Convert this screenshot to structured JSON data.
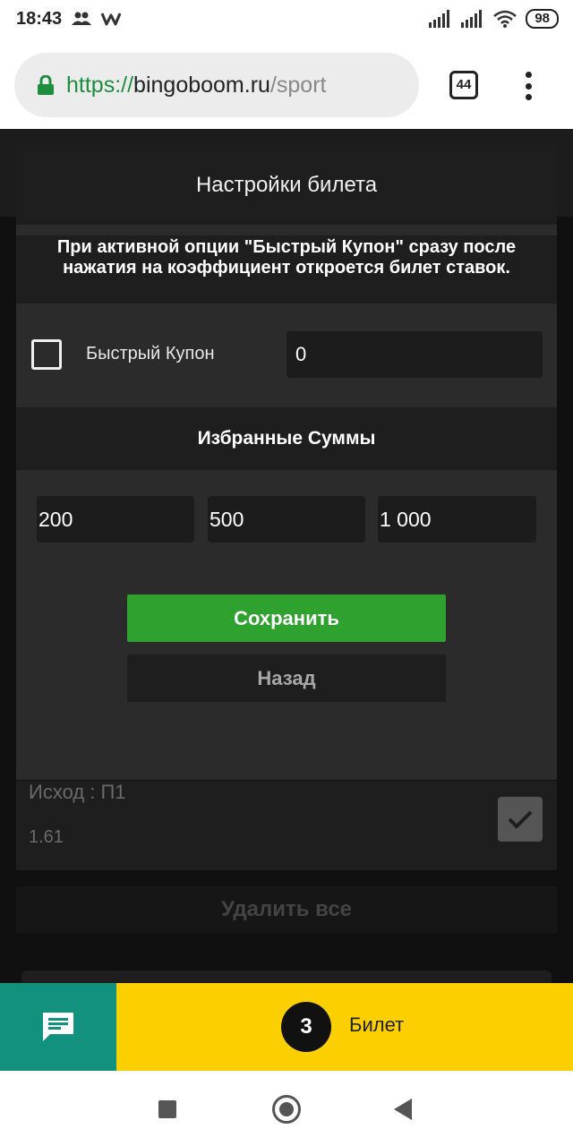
{
  "status_bar": {
    "time": "18:43",
    "battery": "98"
  },
  "browser": {
    "url_scheme": "https://",
    "url_host": "bingoboom.ru",
    "url_path": "/sport",
    "tab_count": "44"
  },
  "background_page": {
    "outcome_label": "Исход : П1",
    "outcome_odds": "1.61",
    "delete_all_label": "Удалить все"
  },
  "modal": {
    "title": "Настройки билета",
    "info_text": "При активной опции \"Быстрый Купон\" сразу после нажатия на коэффициент откроется билет ставок.",
    "quick_coupon": {
      "label": "Быстрый Купон",
      "checked": false,
      "value": "0"
    },
    "favorites_title": "Избранные Суммы",
    "favorite_amounts": [
      "200",
      "500",
      "1 000"
    ],
    "save_label": "Сохранить",
    "back_label": "Назад"
  },
  "bottom_bar": {
    "ticket_count": "3",
    "ticket_label": "Билет"
  },
  "colors": {
    "save_green": "#2ea12e",
    "ticket_yellow": "#fccf00",
    "chat_teal": "#13917f",
    "url_green": "#1e8e3e"
  }
}
